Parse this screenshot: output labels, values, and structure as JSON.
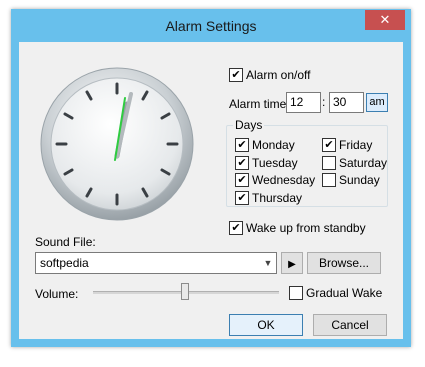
{
  "window": {
    "title": "Alarm Settings",
    "close_glyph": "✕"
  },
  "alarm": {
    "toggle_label": "Alarm on/off",
    "toggle_checked": true,
    "time_label": "Alarm time:",
    "hour": "12",
    "separator": ":",
    "minute": "30",
    "ampm": "am"
  },
  "days": {
    "group_label": "Days",
    "items": [
      {
        "label": "Monday",
        "checked": true
      },
      {
        "label": "Tuesday",
        "checked": true
      },
      {
        "label": "Wednesday",
        "checked": true
      },
      {
        "label": "Thursday",
        "checked": true
      },
      {
        "label": "Friday",
        "checked": true
      },
      {
        "label": "Saturday",
        "checked": false
      },
      {
        "label": "Sunday",
        "checked": false
      }
    ]
  },
  "wake_standby": {
    "label": "Wake up from standby",
    "checked": true
  },
  "sound": {
    "label": "Sound File:",
    "value": "softpedia",
    "play_glyph": "▶",
    "browse_label": "Browse..."
  },
  "volume": {
    "label": "Volume:",
    "level": 0.49
  },
  "gradual_wake": {
    "label": "Gradual Wake",
    "checked": false
  },
  "buttons": {
    "ok": "OK",
    "cancel": "Cancel"
  },
  "colors": {
    "frame": "#68c0ec",
    "close_button": "#c75050",
    "second_hand": "#2ecc40"
  },
  "icons": {
    "check": "✔",
    "dropdown": "chevron-down-icon",
    "play": "play-icon",
    "close": "close-icon"
  }
}
